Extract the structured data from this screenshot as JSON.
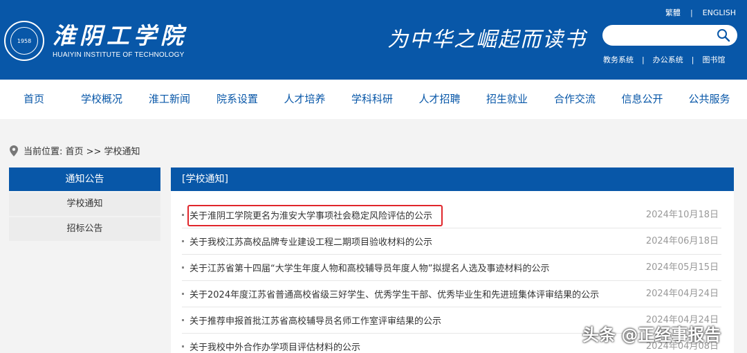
{
  "header": {
    "logo": {
      "cn": "淮阴工学院",
      "en": "HUAIYIN INSTITUTE OF TECHNOLOGY",
      "seal_text": "1958"
    },
    "motto": "为中华之崛起而读书",
    "lang_links": [
      "繁體",
      "ENGLISH"
    ],
    "search": {
      "placeholder": ""
    },
    "sys_links": [
      "教务系统",
      "办公系统",
      "图书馆"
    ],
    "colors": {
      "brand": "#0857a8"
    }
  },
  "nav": {
    "items": [
      "首页",
      "学校概况",
      "淮工新闻",
      "院系设置",
      "人才培养",
      "学科科研",
      "人才招聘",
      "招生就业",
      "合作交流",
      "信息公开",
      "公共服务"
    ]
  },
  "breadcrumb": {
    "text": "当前位置: 首页 >> 学校通知"
  },
  "sidebar": {
    "title": "通知公告",
    "items": [
      "学校通知",
      "招标公告"
    ]
  },
  "main": {
    "header": "[学校通知]",
    "notices": [
      {
        "title": "关于淮阴工学院更名为淮安大学事项社会稳定风险评估的公示",
        "date": "2024年10月18日"
      },
      {
        "title": "关于我校江苏高校品牌专业建设工程二期项目验收材料的公示",
        "date": "2024年06月18日"
      },
      {
        "title": "关于江苏省第十四届“大学生年度人物和高校辅导员年度人物”拟提名人选及事迹材料的公示",
        "date": "2024年05月15日"
      },
      {
        "title": "关于2024年度江苏省普通高校省级三好学生、优秀学生干部、优秀毕业生和先进班集体评审结果的公示",
        "date": "2024年04月24日"
      },
      {
        "title": "关于推荐申报首批江苏省高校辅导员名师工作室评审结果的公示",
        "date": "2024年04月24日"
      },
      {
        "title": "关于我校中外合作办学项目评估材料的公示",
        "date": "2024年04月08日"
      }
    ]
  },
  "watermark": "头条 @正经事报告"
}
